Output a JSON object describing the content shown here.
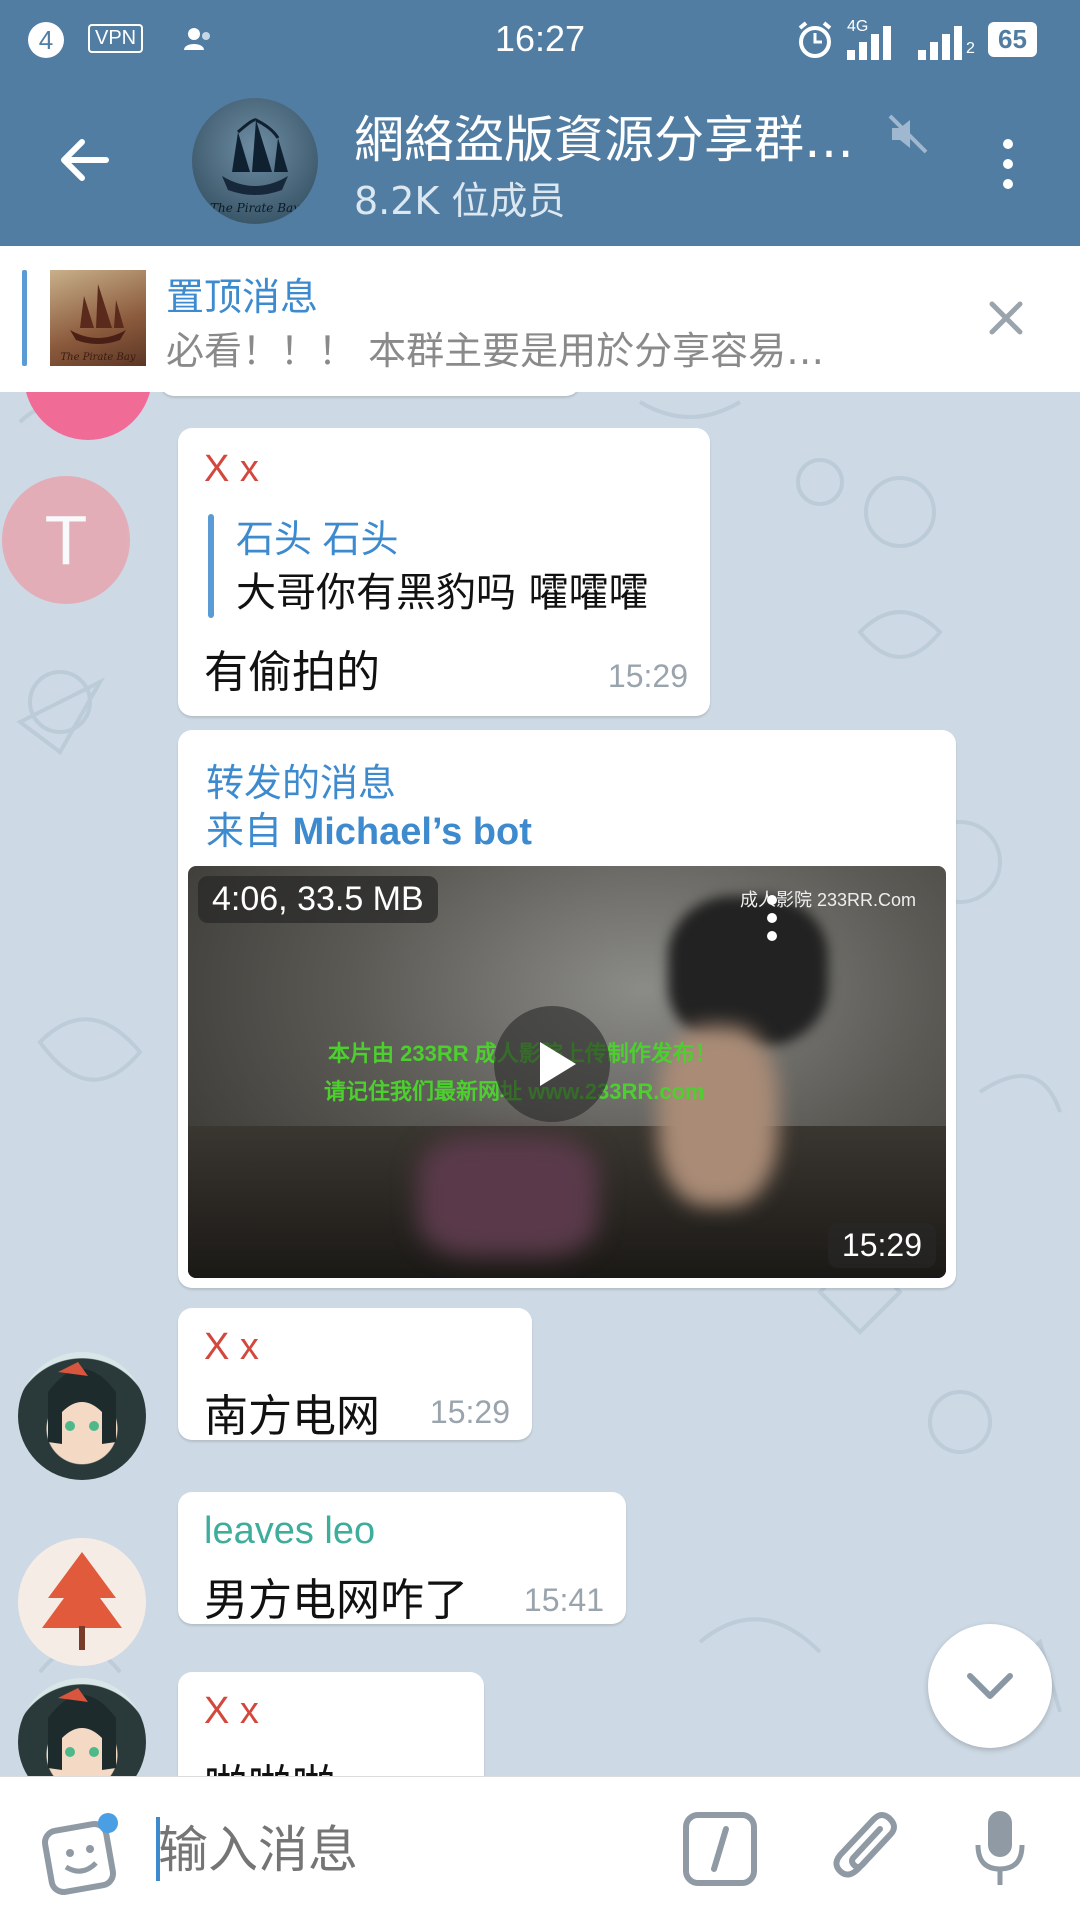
{
  "status_bar": {
    "notification_count": "4",
    "vpn_label": "VPN",
    "time": "16:27",
    "network_label": "4G",
    "sim2_label": "2",
    "battery": "65"
  },
  "header": {
    "title": "網絡盜版資源分享群…",
    "subtitle": "8.2K 位成员",
    "avatar_logo_text": "The Pirate Bay"
  },
  "pinned": {
    "title": "置顶消息",
    "text": "必看！！！ 本群主要是用於分享容易…",
    "thumb_logo_text": "The Pirate Bay"
  },
  "messages": [
    {
      "sender": "X x",
      "reply_to_name": "石头 石头",
      "reply_to_text": "大哥你有黑豹吗  嚯嚯嚯",
      "text": "有偷拍的",
      "time": "15:29",
      "avatar_letter": "T"
    },
    {
      "forward_label": "转发的消息",
      "forward_from_prefix": "来自",
      "forward_from": "Michael’s bot",
      "video_info": "4:06, 33.5 MB",
      "time": "15:29",
      "watermark": "成人影院 233RR.Com",
      "overlay_line1": "本片由 233RR 成人影院上传制作发布！",
      "overlay_line2": "请记住我们最新网址  www.233RR.com"
    },
    {
      "sender": "X x",
      "text": "南方电网",
      "time": "15:29"
    },
    {
      "sender": "leaves leo",
      "text": "男方电网咋了",
      "time": "15:41"
    },
    {
      "sender": "X x",
      "text": "啪啪啪"
    }
  ],
  "input": {
    "placeholder": "输入消息"
  },
  "colors": {
    "header_bg": "#527da3",
    "accent_blue": "#3d8bce",
    "name_red": "#d3473c",
    "name_teal": "#3fad9c",
    "chat_bg": "#cdd9e4"
  }
}
